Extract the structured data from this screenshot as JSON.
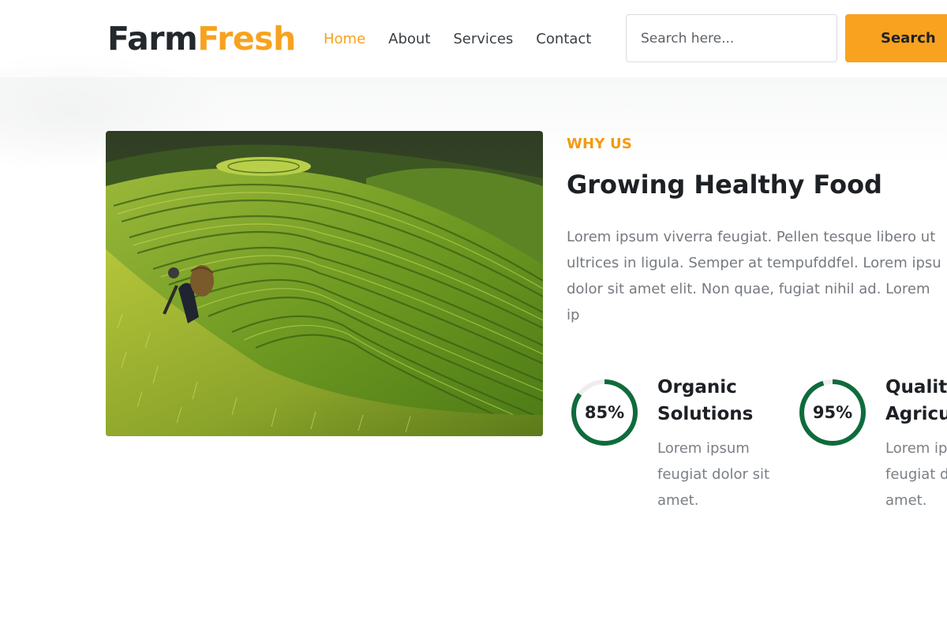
{
  "brand": {
    "part_a": "Farm",
    "part_b": "Fresh",
    "color_primary": "#23282d",
    "color_accent": "#f7a21e"
  },
  "nav": {
    "items": [
      {
        "label": "Home",
        "active": true
      },
      {
        "label": "About",
        "active": false
      },
      {
        "label": "Services",
        "active": false
      },
      {
        "label": "Contact",
        "active": false
      }
    ]
  },
  "search": {
    "placeholder": "Search here...",
    "value": "",
    "button_label": "Search",
    "button_color": "#f9a21f"
  },
  "hero_image": {
    "subject": "terraced rice fields with farmer carrying a basket"
  },
  "about": {
    "eyebrow": "WHY US",
    "title": "Growing Healthy Food",
    "paragraph": "Lorem ipsum viverra feugiat. Pellen tesque libero ut\nultrices in ligula. Semper at tempufddfel. Lorem ipsu\ndolor sit amet elit. Non quae, fugiat nihil ad. Lorem ip\ndolor sit amet."
  },
  "stats": [
    {
      "value": "85%",
      "percent": 85,
      "title": "Organic\nSolutions",
      "text": "Lorem ipsum\nfeugiat dolor sit\namet."
    },
    {
      "value": "95%",
      "percent": 95,
      "title": "Quality\nAgricul",
      "text": "Lorem ip\nfeugiat d\namet."
    }
  ],
  "colors": {
    "ring": "#0f6b3c",
    "ring_track": "#eeeeee",
    "eyebrow": "#f39a14",
    "body_text": "#757a80"
  }
}
